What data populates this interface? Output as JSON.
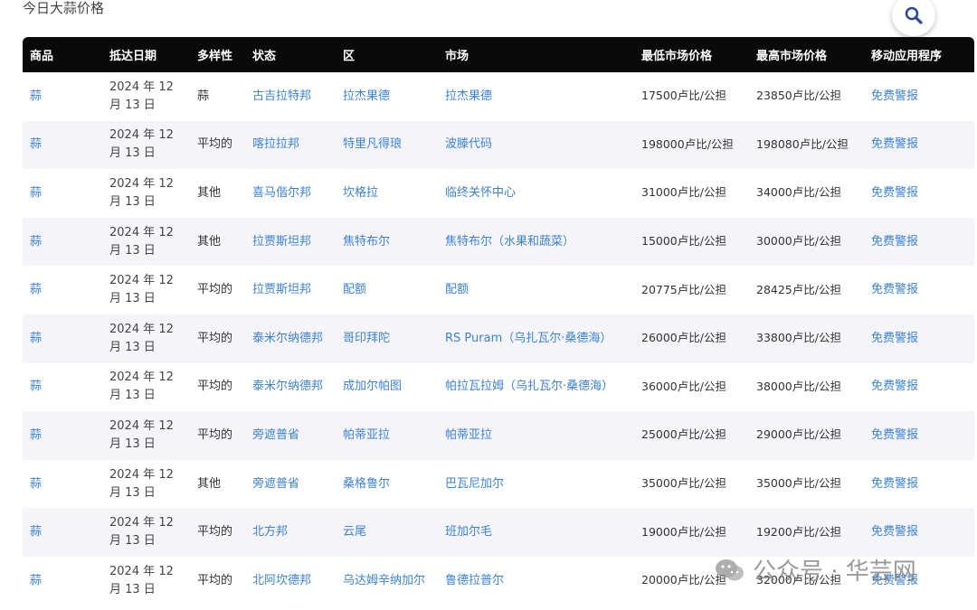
{
  "page": {
    "title": "今日大蒜价格",
    "search_icon": "search-icon"
  },
  "table": {
    "columns": [
      "商品",
      "抵达日期",
      "多样性",
      "状态",
      "区",
      "市场",
      "最低市场价格",
      "最高市场价格",
      "移动应用程序"
    ],
    "rows": [
      {
        "commodity": "蒜",
        "date": "2024 年 12 月 13 日",
        "variety": "蒜",
        "state": "古吉拉特邦",
        "district": "拉杰果德",
        "market": "拉杰果德",
        "min_price": "17500卢比/公担",
        "max_price": "23850卢比/公担",
        "app": "免费警报"
      },
      {
        "commodity": "蒜",
        "date": "2024 年 12 月 13 日",
        "variety": "平均的",
        "state": "喀拉拉邦",
        "district": "特里凡得琅",
        "market": "波滕代码",
        "min_price": "198000卢比/公担",
        "max_price": "198080卢比/公担",
        "app": "免费警报"
      },
      {
        "commodity": "蒜",
        "date": "2024 年 12 月 13 日",
        "variety": "其他",
        "state": "喜马偕尔邦",
        "district": "坎格拉",
        "market": "临终关怀中心",
        "min_price": "31000卢比/公担",
        "max_price": "34000卢比/公担",
        "app": "免费警报"
      },
      {
        "commodity": "蒜",
        "date": "2024 年 12 月 13 日",
        "variety": "其他",
        "state": "拉贾斯坦邦",
        "district": "焦特布尔",
        "market": "焦特布尔（水果和蔬菜）",
        "min_price": "15000卢比/公担",
        "max_price": "30000卢比/公担",
        "app": "免费警报"
      },
      {
        "commodity": "蒜",
        "date": "2024 年 12 月 13 日",
        "variety": "平均的",
        "state": "拉贾斯坦邦",
        "district": "配额",
        "market": "配额",
        "min_price": "20775卢比/公担",
        "max_price": "28425卢比/公担",
        "app": "免费警报"
      },
      {
        "commodity": "蒜",
        "date": "2024 年 12 月 13 日",
        "variety": "平均的",
        "state": "泰米尔纳德邦",
        "district": "哥印拜陀",
        "market": "RS Puram（乌扎瓦尔·桑德海）",
        "min_price": "26000卢比/公担",
        "max_price": "33800卢比/公担",
        "app": "免费警报"
      },
      {
        "commodity": "蒜",
        "date": "2024 年 12 月 13 日",
        "variety": "平均的",
        "state": "泰米尔纳德邦",
        "district": "成加尔帕图",
        "market": "帕拉瓦拉姆（乌扎瓦尔·桑德海）",
        "min_price": "36000卢比/公担",
        "max_price": "38000卢比/公担",
        "app": "免费警报"
      },
      {
        "commodity": "蒜",
        "date": "2024 年 12 月 13 日",
        "variety": "平均的",
        "state": "旁遮普省",
        "district": "帕蒂亚拉",
        "market": "帕蒂亚拉",
        "min_price": "25000卢比/公担",
        "max_price": "29000卢比/公担",
        "app": "免费警报"
      },
      {
        "commodity": "蒜",
        "date": "2024 年 12 月 13 日",
        "variety": "其他",
        "state": "旁遮普省",
        "district": "桑格鲁尔",
        "market": "巴瓦尼加尔",
        "min_price": "35000卢比/公担",
        "max_price": "35000卢比/公担",
        "app": "免费警报"
      },
      {
        "commodity": "蒜",
        "date": "2024 年 12 月 13 日",
        "variety": "平均的",
        "state": "北方邦",
        "district": "云尾",
        "market": "班加尔毛",
        "min_price": "19000卢比/公担",
        "max_price": "19200卢比/公担",
        "app": "免费警报"
      },
      {
        "commodity": "蒜",
        "date": "2024 年 12 月 13 日",
        "variety": "平均的",
        "state": "北阿坎德邦",
        "district": "乌达姆辛纳加尔",
        "market": "鲁德拉普尔",
        "min_price": "20000卢比/公担",
        "max_price": "32000卢比/公担",
        "app": "免费警报"
      }
    ]
  },
  "watermark": {
    "text": "公众号 · 华芸网",
    "icon": "wechat-icon"
  },
  "colors": {
    "header_bg": "#0a0a0a",
    "link": "#3b82d9",
    "row_alt": "#f5f5f9"
  }
}
